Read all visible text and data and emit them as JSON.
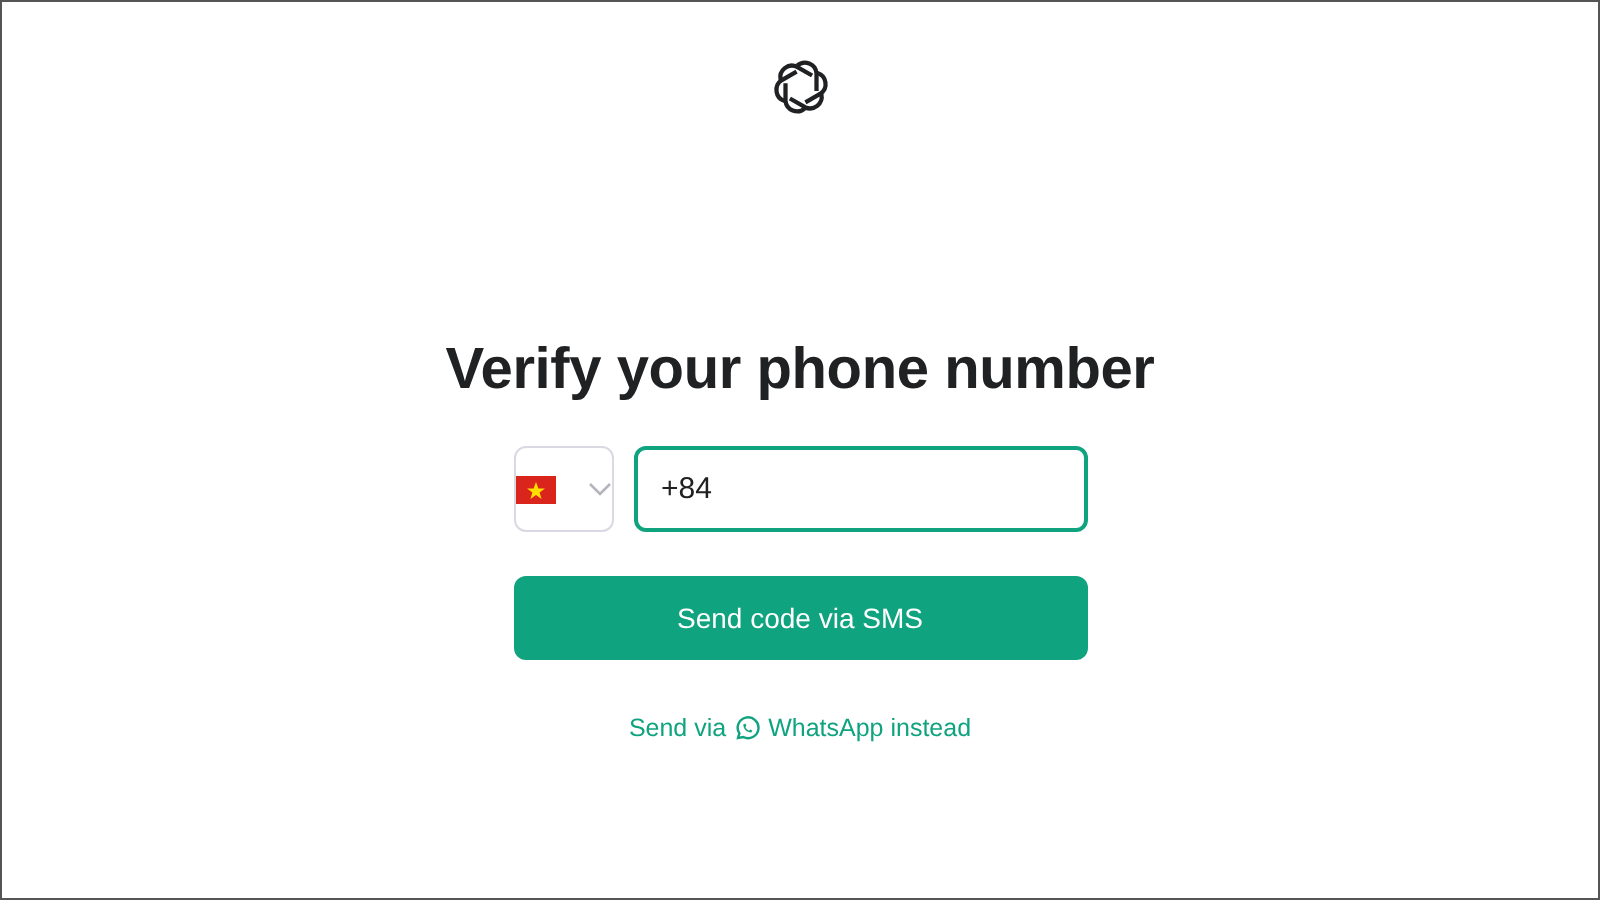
{
  "title": "Verify your phone number",
  "phone_field": {
    "value": "+84",
    "focused": true
  },
  "submit_button": {
    "label": "Send code via SMS"
  },
  "alt_link": {
    "before": "Send via",
    "after": "WhatsApp instead"
  }
}
